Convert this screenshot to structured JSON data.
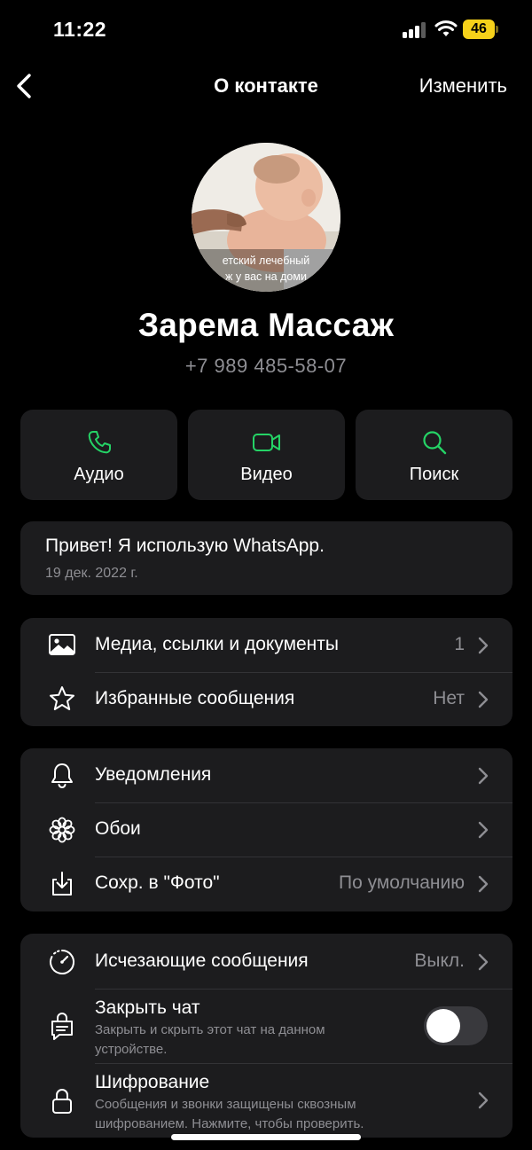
{
  "status_bar": {
    "time": "11:22",
    "battery": "46"
  },
  "nav": {
    "title": "О контакте",
    "edit_label": "Изменить"
  },
  "avatar": {
    "caption_line1": "етский лечебный",
    "caption_line2": "ж у вас на доми"
  },
  "contact": {
    "name": "Зарема Массаж",
    "phone": "+7 989 485-58-07"
  },
  "actions": [
    {
      "label": "Аудио",
      "icon": "phone-icon"
    },
    {
      "label": "Видео",
      "icon": "video-icon"
    },
    {
      "label": "Поиск",
      "icon": "search-icon"
    }
  ],
  "about": {
    "text": "Привет! Я использую WhatsApp.",
    "date": "19 дек. 2022 г."
  },
  "media_group": [
    {
      "label": "Медиа, ссылки и документы",
      "value": "1",
      "icon": "image-icon"
    },
    {
      "label": "Избранные сообщения",
      "value": "Нет",
      "icon": "star-icon"
    }
  ],
  "settings_group": [
    {
      "label": "Уведомления",
      "value": "",
      "icon": "bell-icon"
    },
    {
      "label": "Обои",
      "value": "",
      "icon": "flower-icon"
    },
    {
      "label": "Сохр. в \"Фото\"",
      "value": "По умолчанию",
      "icon": "download-icon"
    }
  ],
  "privacy_group": {
    "disappearing": {
      "label": "Исчезающие сообщения",
      "value": "Выкл.",
      "icon": "timer-icon"
    },
    "lock_chat": {
      "label": "Закрыть чат",
      "sub": "Закрыть и скрыть этот чат на данном устройстве.",
      "icon": "chat-lock-icon",
      "enabled": false
    },
    "encryption": {
      "label": "Шифрование",
      "sub": "Сообщения и звонки защищены сквозным шифрованием. Нажмите, чтобы проверить.",
      "icon": "lock-icon"
    }
  },
  "colors": {
    "accent": "#25d366",
    "card": "#1c1c1e",
    "secondary_text": "#8e8e93",
    "battery": "#f6d11a"
  }
}
